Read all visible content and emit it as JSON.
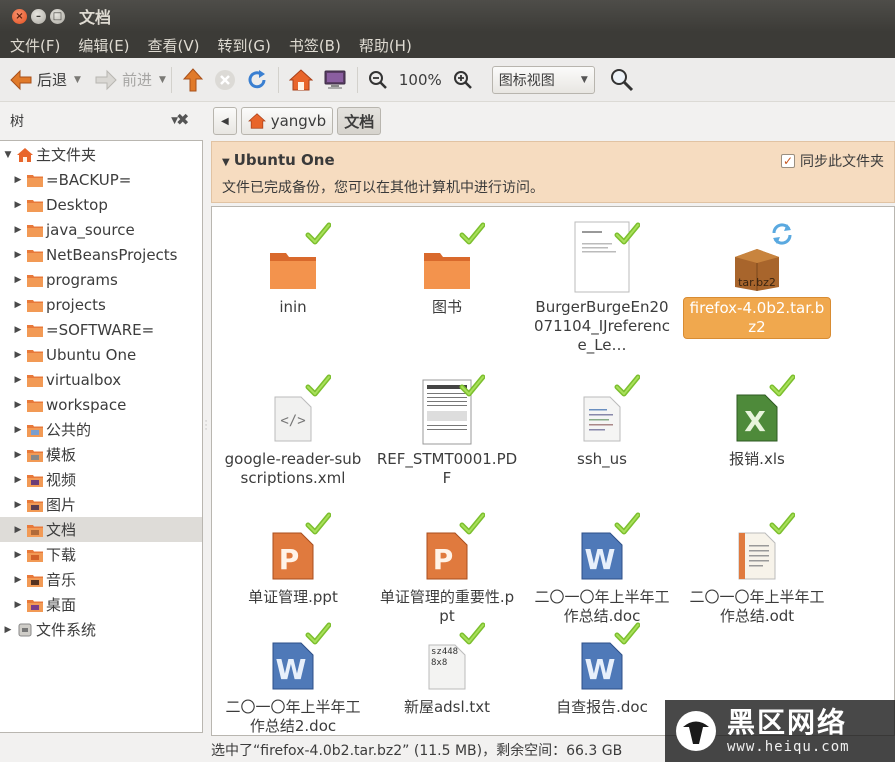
{
  "window": {
    "title": "文档"
  },
  "menu": [
    "文件(F)",
    "编辑(E)",
    "查看(V)",
    "转到(G)",
    "书签(B)",
    "帮助(H)"
  ],
  "toolbar": {
    "back_label": "后退",
    "forward_label": "前进",
    "zoom_level": "100%",
    "view_mode": "图标视图"
  },
  "sidebar": {
    "mode_label": "树",
    "items": [
      {
        "label": "主文件夹",
        "level": 0,
        "icon": "home-folder-icon"
      },
      {
        "label": "=BACKUP=",
        "level": 1,
        "icon": "folder-icon"
      },
      {
        "label": "Desktop",
        "level": 1,
        "icon": "folder-icon"
      },
      {
        "label": "java_source",
        "level": 1,
        "icon": "folder-icon"
      },
      {
        "label": "NetBeansProjects",
        "level": 1,
        "icon": "folder-icon"
      },
      {
        "label": "programs",
        "level": 1,
        "icon": "folder-icon"
      },
      {
        "label": "projects",
        "level": 1,
        "icon": "folder-icon"
      },
      {
        "label": "=SOFTWARE=",
        "level": 1,
        "icon": "folder-icon"
      },
      {
        "label": "Ubuntu One",
        "level": 1,
        "icon": "folder-icon"
      },
      {
        "label": "virtualbox",
        "level": 1,
        "icon": "folder-icon"
      },
      {
        "label": "workspace",
        "level": 1,
        "icon": "folder-icon"
      },
      {
        "label": "公共的",
        "level": 1,
        "icon": "public-folder-icon"
      },
      {
        "label": "模板",
        "level": 1,
        "icon": "templates-folder-icon"
      },
      {
        "label": "视频",
        "level": 1,
        "icon": "videos-folder-icon"
      },
      {
        "label": "图片",
        "level": 1,
        "icon": "pictures-folder-icon"
      },
      {
        "label": "文档",
        "level": 1,
        "icon": "documents-folder-icon",
        "selected": true
      },
      {
        "label": "下载",
        "level": 1,
        "icon": "downloads-folder-icon"
      },
      {
        "label": "音乐",
        "level": 1,
        "icon": "music-folder-icon"
      },
      {
        "label": "桌面",
        "level": 1,
        "icon": "desktop-folder-icon"
      },
      {
        "label": "文件系统",
        "level": 0,
        "icon": "filesystem-icon"
      }
    ]
  },
  "pathbar": {
    "parent": "yangvb",
    "current": "文档"
  },
  "banner": {
    "title": "Ubuntu One",
    "message": "文件已完成备份，您可以在其他计算机中进行访问。",
    "sync_label": "同步此文件夹"
  },
  "files": [
    {
      "name": "inin",
      "type": "folder"
    },
    {
      "name": "图书",
      "type": "folder"
    },
    {
      "name": "BurgerBurgeEn20071104_IJreference_Le…",
      "type": "pdf-preview"
    },
    {
      "name": "firefox-4.0b2.tar.bz2",
      "type": "archive",
      "selected": true,
      "archive_label": "tar.bz2"
    },
    {
      "name": "google-reader-subscriptions.xml",
      "type": "xml"
    },
    {
      "name": "REF_STMT0001.PDF",
      "type": "pdf-doc"
    },
    {
      "name": "ssh_us",
      "type": "text"
    },
    {
      "name": "报销.xls",
      "type": "xls"
    },
    {
      "name": "单证管理.ppt",
      "type": "ppt"
    },
    {
      "name": "单证管理的重要性.ppt",
      "type": "ppt"
    },
    {
      "name": "二〇一〇年上半年工作总结.doc",
      "type": "doc"
    },
    {
      "name": "二〇一〇年上半年工作总结.odt",
      "type": "odt"
    },
    {
      "name": "二〇一〇年上半年工作总结2.doc",
      "type": "doc"
    },
    {
      "name": "新屋adsl.txt",
      "type": "txt",
      "preview": "sz448\n8x8"
    },
    {
      "name": "自查报告.doc",
      "type": "doc"
    }
  ],
  "status": {
    "text": "选中了“firefox-4.0b2.tar.bz2” (11.5 MB)，剩余空间：66.3 GB"
  },
  "watermark": {
    "title": "黑区网络",
    "url": "www.heiqu.com"
  },
  "colors": {
    "accent": "#f0a84e",
    "banner_bg": "#f6dcc0",
    "titlebar": "#3c3b37"
  }
}
